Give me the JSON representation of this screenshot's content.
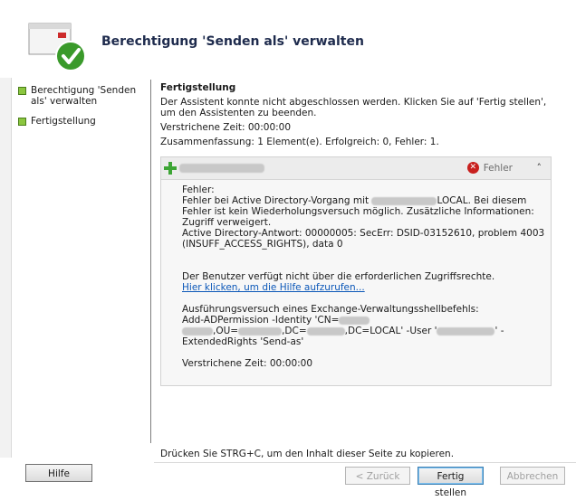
{
  "wizard": {
    "title": "Berechtigung 'Senden als' verwalten"
  },
  "nav": {
    "items": [
      {
        "label": "Berechtigung 'Senden als' verwalten"
      },
      {
        "label": "Fertigstellung"
      }
    ]
  },
  "content": {
    "section_title": "Fertigstellung",
    "intro": "Der Assistent konnte nicht abgeschlossen werden. Klicken Sie auf 'Fertig stellen', um den Assistenten zu beenden.",
    "elapsed": "Verstrichene Zeit: 00:00:00",
    "summary": "Zusammenfassung: 1 Element(e). Erfolgreich: 0, Fehler: 1."
  },
  "result": {
    "status": "Fehler",
    "lines": {
      "l1": "Fehler:",
      "l2a": "Fehler bei Active Directory-Vorgang mit",
      "l2b": "LOCAL. Bei diesem",
      "l3": "Fehler ist kein Wiederholungsversuch möglich. Zusätzliche Informationen:",
      "l4": "Zugriff verweigert.",
      "l5": "Active Directory-Antwort: 00000005: SecErr: DSID-03152610, problem 4003",
      "l6": "(INSUFF_ACCESS_RIGHTS), data 0",
      "l7": "Der Benutzer verfügt nicht über die erforderlichen Zugriffsrechte.",
      "link": "Hier klicken, um die Hilfe aufzurufen...",
      "l8": "Ausführungsversuch eines Exchange-Verwaltungsshellbefehls:",
      "l9": "Add-ADPermission -Identity 'CN=",
      "l10a": ",OU=",
      "l10b": ",DC=",
      "l10c": ",DC=LOCAL' -User '",
      "l10d": "' -",
      "l11": "ExtendedRights 'Send-as'",
      "elapsed": "Verstrichene Zeit: 00:00:00"
    }
  },
  "footer": {
    "copy_hint": "Drücken Sie STRG+C, um den Inhalt dieser Seite zu kopieren.",
    "help": "Hilfe",
    "back": "< Zurück",
    "finish": "Fertig stellen",
    "cancel": "Abbrechen"
  }
}
